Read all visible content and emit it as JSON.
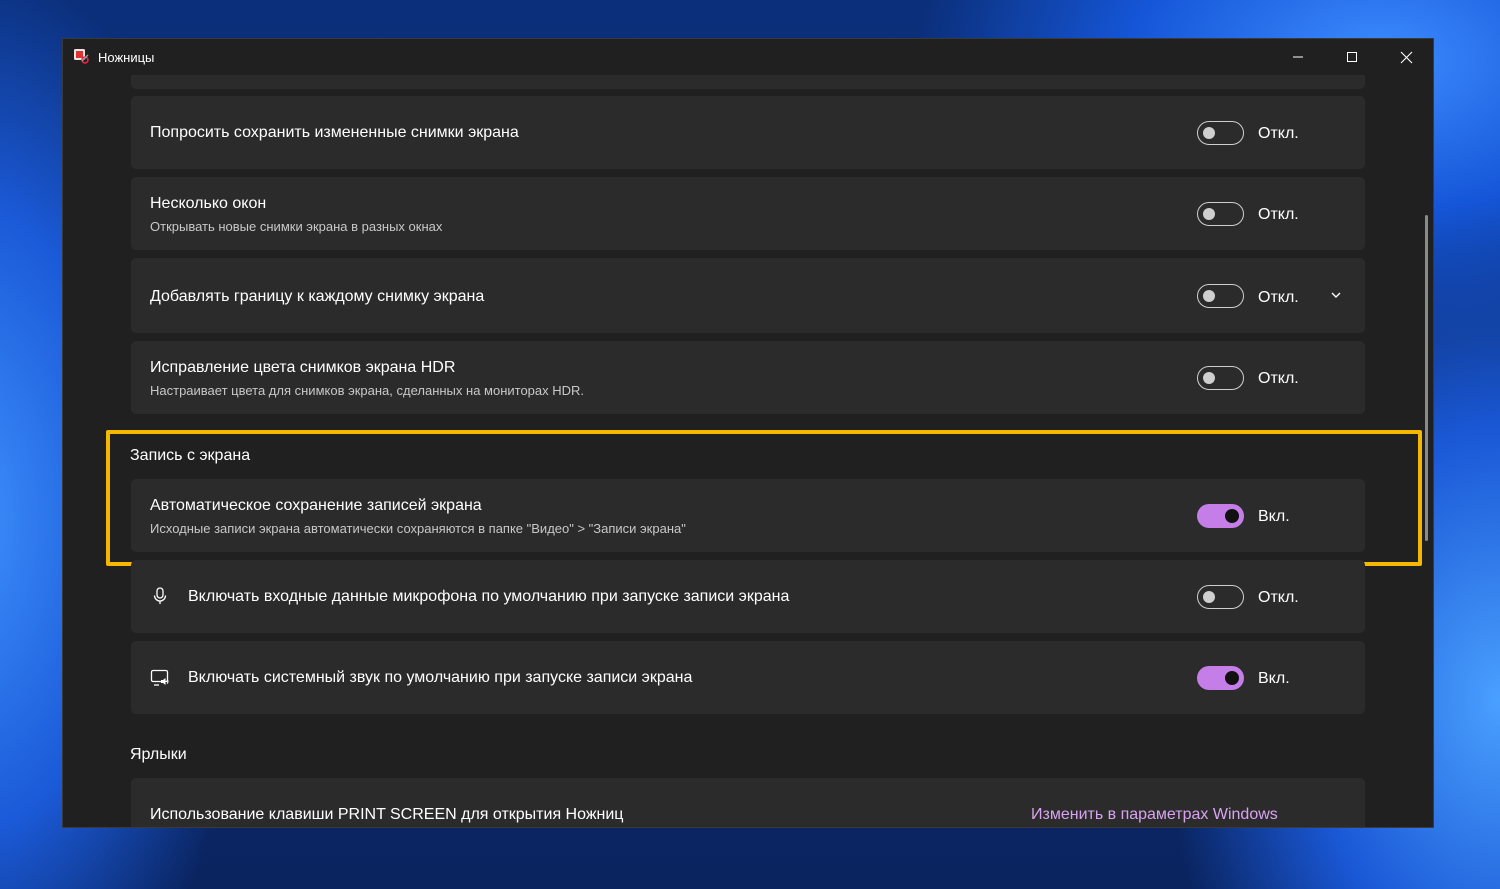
{
  "window": {
    "title": "Ножницы",
    "minimize_icon": "minimize-icon",
    "maximize_icon": "maximize-icon",
    "close_icon": "close-icon"
  },
  "settings": [
    {
      "title": "Попросить сохранить измененные снимки экрана",
      "subtitle": "",
      "state": "Откл.",
      "on": false
    },
    {
      "title": "Несколько окон",
      "subtitle": "Открывать новые снимки экрана в разных окнах",
      "state": "Откл.",
      "on": false
    },
    {
      "title": "Добавлять границу к каждому снимку экрана",
      "subtitle": "",
      "state": "Откл.",
      "on": false,
      "expand_icon": "chevron-down-icon"
    },
    {
      "title": "Исправление цвета снимков экрана HDR",
      "subtitle": "Настраивает цвета для снимков экрана, сделанных на мониторах HDR.",
      "state": "Откл.",
      "on": false
    }
  ],
  "screen_recording": {
    "heading": "Запись с экрана",
    "auto_save": {
      "title": "Автоматическое сохранение записей экрана",
      "subtitle": "Исходные записи экрана автоматически сохраняются в папке \"Видео\" > \"Записи экрана\"",
      "state": "Вкл.",
      "on": true
    },
    "microphone": {
      "icon": "microphone-icon",
      "title": "Включать входные данные микрофона по умолчанию при запуске записи экрана",
      "state": "Откл.",
      "on": false
    },
    "system_audio": {
      "icon": "system-audio-icon",
      "title": "Включать системный звук по умолчанию при запуске записи экрана",
      "state": "Вкл.",
      "on": true
    }
  },
  "shortcuts": {
    "heading": "Ярлыки",
    "print_screen": {
      "title": "Использование клавиши PRINT SCREEN для открытия Ножниц",
      "link": "Изменить в параметрах Windows"
    }
  },
  "colors": {
    "accent": "#c57ee8",
    "highlight_border": "#f5b800",
    "card_bg": "#2b2b2b",
    "window_bg": "#202020"
  }
}
